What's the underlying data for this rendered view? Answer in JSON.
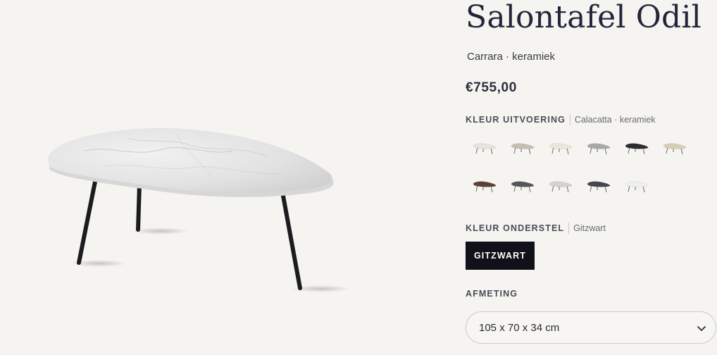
{
  "product": {
    "title": "Salontafel Odil",
    "subtitle": "Carrara · keramiek",
    "price": "€755,00"
  },
  "color_option": {
    "label": "KLEUR UITVOERING",
    "selected": "Calacatta · keramiek",
    "swatch_colors": [
      "#e7e3dc",
      "#c5bdb0",
      "#ece6da",
      "#a9aaa6",
      "#2d2d30",
      "#d8cdb9",
      "#5a4236",
      "#55565a",
      "#d2d2d0",
      "#46474c",
      "#efefee"
    ]
  },
  "base_option": {
    "label": "KLEUR ONDERSTEL",
    "selected": "Gitzwart",
    "button_label": "GITZWART"
  },
  "size_option": {
    "label": "AFMETING",
    "selected": "105 x 70 x 34 cm"
  },
  "icons": {
    "select": "chevron-down-icon"
  }
}
